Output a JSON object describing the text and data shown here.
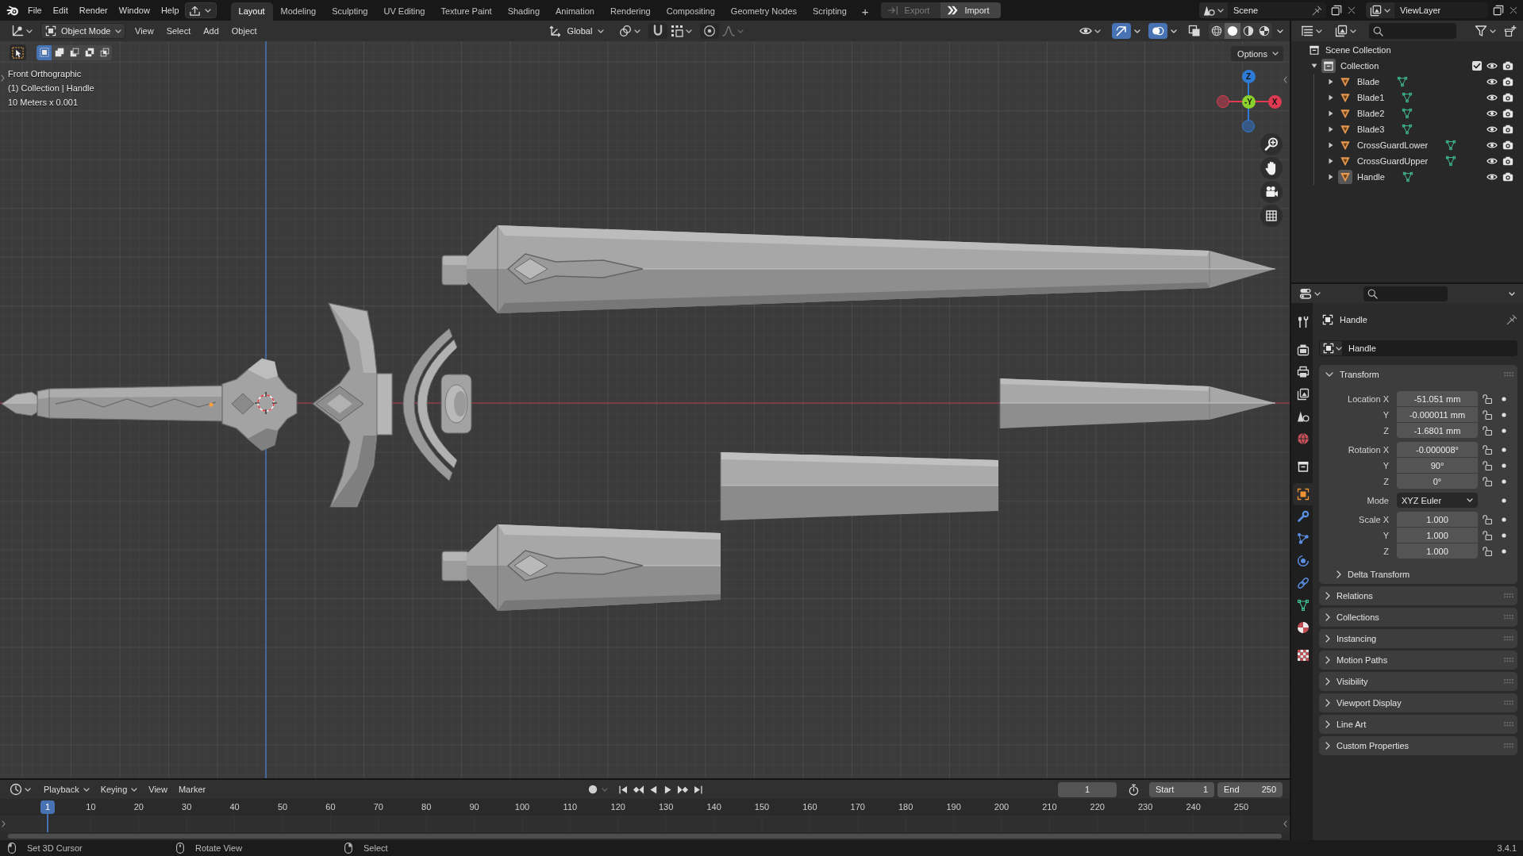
{
  "top_bar": {
    "menus": [
      "File",
      "Edit",
      "Render",
      "Window",
      "Help"
    ],
    "workspaces": [
      {
        "label": "Layout",
        "selected": true
      },
      {
        "label": "Modeling",
        "selected": false
      },
      {
        "label": "Sculpting",
        "selected": false
      },
      {
        "label": "UV Editing",
        "selected": false
      },
      {
        "label": "Texture Paint",
        "selected": false
      },
      {
        "label": "Shading",
        "selected": false
      },
      {
        "label": "Animation",
        "selected": false
      },
      {
        "label": "Rendering",
        "selected": false
      },
      {
        "label": "Compositing",
        "selected": false
      },
      {
        "label": "Geometry Nodes",
        "selected": false
      },
      {
        "label": "Scripting",
        "selected": false
      }
    ],
    "add_tab": "+",
    "actions": [
      {
        "kind": "export",
        "label": "Export",
        "disabled": true
      },
      {
        "kind": "import",
        "label": "Import",
        "disabled": false
      }
    ],
    "scene": "Scene",
    "view_layer": "ViewLayer"
  },
  "viewport": {
    "header": {
      "mode": "Object Mode",
      "menus": [
        "View",
        "Select",
        "Add",
        "Object"
      ],
      "orientation": "Global",
      "toggles": [
        {
          "kind": "gizmos",
          "on": true
        },
        {
          "kind": "overlays",
          "on": true
        },
        {
          "kind": "xray",
          "on": false
        }
      ],
      "shading": [
        {
          "kind": "wireframe",
          "selected": false
        },
        {
          "kind": "solid",
          "selected": true
        },
        {
          "kind": "material",
          "selected": false
        },
        {
          "kind": "rendered",
          "selected": false
        }
      ]
    },
    "select_modes": [
      {
        "kind": "set",
        "selected": true
      },
      {
        "kind": "extend",
        "selected": false
      },
      {
        "kind": "subtract",
        "selected": false
      },
      {
        "kind": "difference",
        "selected": false
      },
      {
        "kind": "intersect",
        "selected": false
      }
    ],
    "info": [
      "Front Orthographic",
      "(1) Collection | Handle",
      "10 Meters x 0.001"
    ],
    "options": "Options",
    "gizmo": [
      {
        "label": "Z",
        "color": "#2f7bd8"
      },
      {
        "label": "-Y",
        "color": "#8bd12d"
      },
      {
        "label": "X",
        "color": "#e03a52"
      }
    ]
  },
  "outliner": {
    "root": "Scene Collection",
    "collections": [
      {
        "name": "Collection",
        "expanded": true,
        "active": true,
        "checked": true,
        "children": [
          {
            "name": "Blade",
            "expanded": false,
            "active": false
          },
          {
            "name": "Blade1",
            "expanded": false,
            "active": false
          },
          {
            "name": "Blade2",
            "expanded": false,
            "active": false
          },
          {
            "name": "Blade3",
            "expanded": false,
            "active": false
          },
          {
            "name": "CrossGuardLower",
            "expanded": false,
            "active": false
          },
          {
            "name": "CrossGuardUpper",
            "expanded": false,
            "active": false
          },
          {
            "name": "Handle",
            "expanded": false,
            "active": true
          }
        ]
      }
    ]
  },
  "properties": {
    "tab_groups": [
      [
        {
          "kind": "tool",
          "selected": false
        }
      ],
      [
        {
          "kind": "render",
          "selected": false
        },
        {
          "kind": "output",
          "selected": false
        },
        {
          "kind": "view_layer",
          "selected": false
        },
        {
          "kind": "scene",
          "selected": false
        },
        {
          "kind": "world",
          "selected": false
        }
      ],
      [
        {
          "kind": "collection",
          "selected": false
        }
      ],
      [
        {
          "kind": "object",
          "selected": true
        },
        {
          "kind": "modifiers",
          "selected": false
        },
        {
          "kind": "particles",
          "selected": false
        },
        {
          "kind": "physics",
          "selected": false
        },
        {
          "kind": "constraints",
          "selected": false
        },
        {
          "kind": "data",
          "selected": false
        },
        {
          "kind": "material",
          "selected": false
        }
      ],
      [
        {
          "kind": "texture",
          "selected": false
        }
      ]
    ],
    "context": "Handle",
    "name": "Handle",
    "panels": [
      {
        "title": "Transform",
        "expanded": true,
        "groups": [
          [
            {
              "kind": "number",
              "label": "Location X",
              "value": "-51.051 mm",
              "locked": false
            },
            {
              "kind": "number",
              "label": "Y",
              "value": "-0.000011 mm",
              "locked": false
            },
            {
              "kind": "number",
              "label": "Z",
              "value": "-1.6801 mm",
              "locked": false
            }
          ],
          [
            {
              "kind": "number",
              "label": "Rotation X",
              "value": "-0.000008°",
              "locked": false
            },
            {
              "kind": "number",
              "label": "Y",
              "value": "90°",
              "locked": false
            },
            {
              "kind": "number",
              "label": "Z",
              "value": "0°",
              "locked": false
            }
          ],
          [
            {
              "kind": "dropdown",
              "label": "Mode",
              "value": "XYZ Euler"
            }
          ],
          [
            {
              "kind": "number",
              "label": "Scale X",
              "value": "1.000",
              "locked": false
            },
            {
              "kind": "number",
              "label": "Y",
              "value": "1.000",
              "locked": false
            },
            {
              "kind": "number",
              "label": "Z",
              "value": "1.000",
              "locked": false
            }
          ]
        ],
        "subpanels": [
          {
            "title": "Delta Transform",
            "expanded": false
          }
        ]
      },
      {
        "title": "Relations",
        "expanded": false
      },
      {
        "title": "Collections",
        "expanded": false
      },
      {
        "title": "Instancing",
        "expanded": false
      },
      {
        "title": "Motion Paths",
        "expanded": false
      },
      {
        "title": "Visibility",
        "expanded": false
      },
      {
        "title": "Viewport Display",
        "expanded": false
      },
      {
        "title": "Line Art",
        "expanded": false
      },
      {
        "title": "Custom Properties",
        "expanded": false
      }
    ]
  },
  "timeline": {
    "menus": [
      {
        "label": "Playback",
        "kind": "dropdown"
      },
      {
        "label": "Keying",
        "kind": "dropdown"
      },
      {
        "label": "View",
        "kind": "menu"
      },
      {
        "label": "Marker",
        "kind": "menu"
      }
    ],
    "auto_keying": false,
    "current_frame": "1",
    "start": {
      "label": "Start",
      "value": "1"
    },
    "end": {
      "label": "End",
      "value": "250"
    },
    "playhead": "1",
    "ruler": [
      "10",
      "20",
      "30",
      "40",
      "50",
      "60",
      "70",
      "80",
      "90",
      "100",
      "110",
      "120",
      "130",
      "140",
      "150",
      "160",
      "170",
      "180",
      "190",
      "200",
      "210",
      "220",
      "230",
      "240",
      "250"
    ]
  },
  "status_bar": {
    "hints": [
      {
        "kind": "left",
        "label": "Set 3D Cursor"
      },
      {
        "kind": "middle",
        "label": "Rotate View"
      },
      {
        "kind": "right",
        "label": "Select"
      }
    ],
    "version": "3.4.1"
  }
}
